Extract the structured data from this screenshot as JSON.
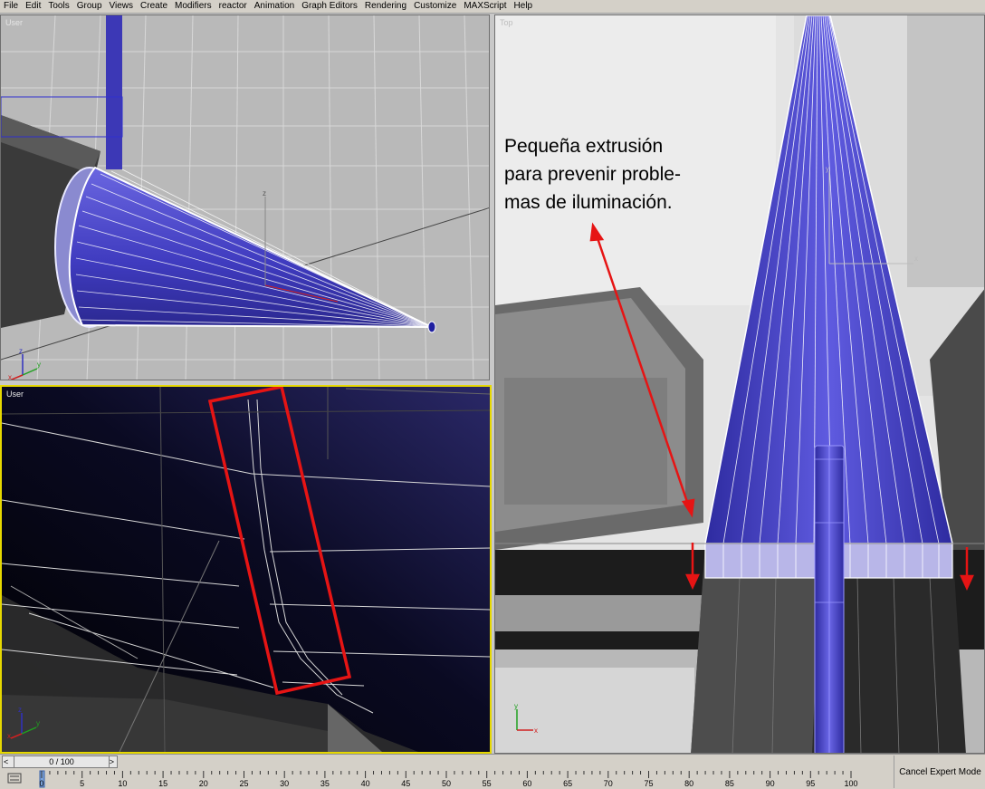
{
  "menu": [
    "File",
    "Edit",
    "Tools",
    "Group",
    "Views",
    "Create",
    "Modifiers",
    "reactor",
    "Animation",
    "Graph Editors",
    "Rendering",
    "Customize",
    "MAXScript",
    "Help"
  ],
  "viewports": {
    "top_left": {
      "label": "User"
    },
    "bottom_left": {
      "label": "User"
    },
    "right": {
      "label": "Top"
    }
  },
  "axis_labels": {
    "x": "x",
    "y": "y",
    "z": "z"
  },
  "annotation": "Pequeña extrusión\npara prevenir proble-\nmas de iluminación.",
  "time_slider": {
    "value": "0 / 100",
    "prev": "<",
    "next": ">"
  },
  "timeline_ticks": [
    "0",
    "5",
    "10",
    "15",
    "20",
    "25",
    "30",
    "35",
    "40",
    "45",
    "50",
    "55",
    "60",
    "65",
    "70",
    "75",
    "80",
    "85",
    "90",
    "95",
    "100"
  ],
  "cancel_expert_label": "Cancel Expert Mode",
  "colors": {
    "mesh_blue": "#4a46c9",
    "highlight_red": "#e61414",
    "active_viewport": "#e6d800"
  }
}
